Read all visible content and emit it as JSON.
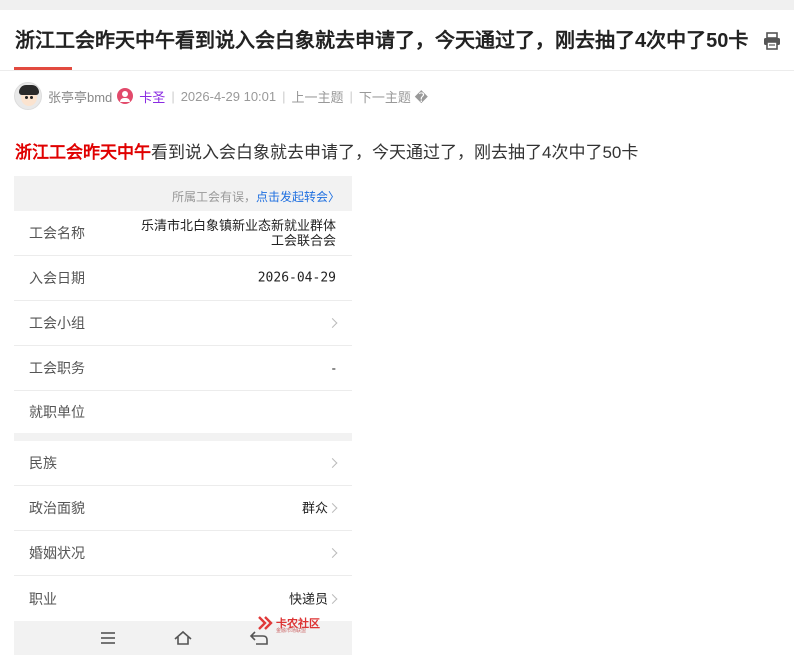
{
  "thread": {
    "title": "浙江工会昨天中午看到说入会白象就去申请了，今天通过了，刚去抽了4次中了50卡"
  },
  "meta": {
    "username": "张亭亭bmd",
    "user_group": "卡圣",
    "date": "2026-4-29 10:01",
    "prev_label": "上一主题",
    "next_label": "下一主题",
    "next_suffix": "�"
  },
  "post": {
    "highlight": "浙江工会昨天中午",
    "rest": "看到说入会白象就去申请了，今天通过了，刚去抽了4次中了50卡"
  },
  "screenshot": {
    "hint_text": "所属工会有误，",
    "hint_link": "点击发起转会",
    "hint_arrow": "〉",
    "card1": [
      {
        "label": "工会名称",
        "value_line1": "乐清市北白象镇新业态新就业群体",
        "value_line2": "工会联合会"
      },
      {
        "label": "入会日期",
        "value": "2026-04-29"
      },
      {
        "label": "工会小组",
        "value": ""
      },
      {
        "label": "工会职务",
        "value": "-"
      },
      {
        "label": "就职单位",
        "value": ""
      }
    ],
    "card2": [
      {
        "label": "民族",
        "value": ""
      },
      {
        "label": "政治面貌",
        "value": "群众"
      },
      {
        "label": "婚姻状况",
        "value": ""
      },
      {
        "label": "职业",
        "value": "快递员"
      }
    ],
    "watermark_text": "卡农社区",
    "watermark_sub": "金融市场联盟"
  },
  "colors": {
    "accent": "#e24a3f",
    "highlight": "#e00000",
    "group": "#8a2be2",
    "link": "#1e6fe0"
  },
  "icons": [
    "print-icon",
    "user-badge-icon",
    "chevron-right-icon",
    "menu-icon",
    "home-icon",
    "back-icon"
  ]
}
